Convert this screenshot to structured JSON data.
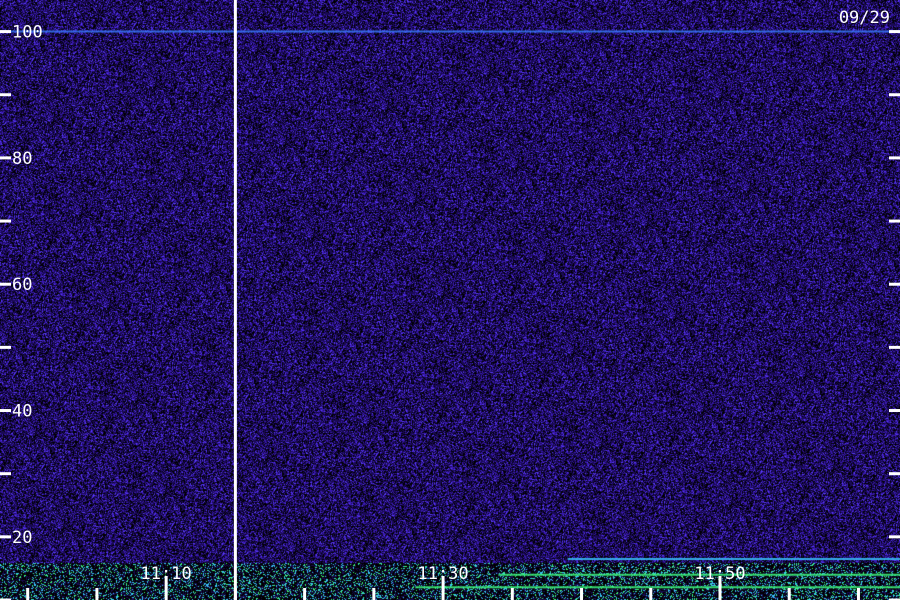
{
  "chart_data": {
    "type": "heatmap",
    "date_label": "09/29",
    "y_ticks": [
      {
        "value": 100,
        "label": "100"
      },
      {
        "value": 90,
        "label": ""
      },
      {
        "value": 80,
        "label": "80"
      },
      {
        "value": 70,
        "label": ""
      },
      {
        "value": 60,
        "label": "60"
      },
      {
        "value": 50,
        "label": ""
      },
      {
        "value": 40,
        "label": "40"
      },
      {
        "value": 30,
        "label": ""
      },
      {
        "value": 20,
        "label": "20"
      },
      {
        "value": 10,
        "label": ""
      }
    ],
    "ylim": [
      10,
      105
    ],
    "x_ticks": [
      {
        "time": "11:10",
        "label": "11:10"
      },
      {
        "time": "11:30",
        "label": "11:30"
      },
      {
        "time": "11:50",
        "label": "11:50"
      }
    ],
    "x_minor_step_minutes": 5,
    "xlim": [
      "10:58",
      "12:03"
    ],
    "gap_marker_time": "11:15",
    "colors": {
      "background": "#000000",
      "noise_dark": "#1a0a55",
      "noise_mid": "#3a1ab4",
      "noise_bright": "#5a3cff",
      "signal_cyan": "#3ac8ff",
      "signal_green": "#40ff80",
      "axis": "#ffffff"
    },
    "features": [
      {
        "kind": "horizontal_line",
        "y": 100,
        "x_start": "10:58",
        "x_end": "12:03",
        "color": "#3a7aff"
      },
      {
        "kind": "band",
        "y_from": 10,
        "y_to": 16,
        "x_start": "10:58",
        "x_end": "12:03",
        "color": "#3ac8ff"
      },
      {
        "kind": "horizontal_line",
        "y": 12,
        "x_start": "11:28",
        "x_end": "12:03",
        "color": "#40ff80"
      },
      {
        "kind": "horizontal_line",
        "y": 14,
        "x_start": "11:34",
        "x_end": "12:03",
        "color": "#40ff80"
      },
      {
        "kind": "horizontal_line",
        "y": 16.5,
        "x_start": "11:39",
        "x_end": "12:03",
        "color": "#3ac8ff"
      }
    ]
  }
}
